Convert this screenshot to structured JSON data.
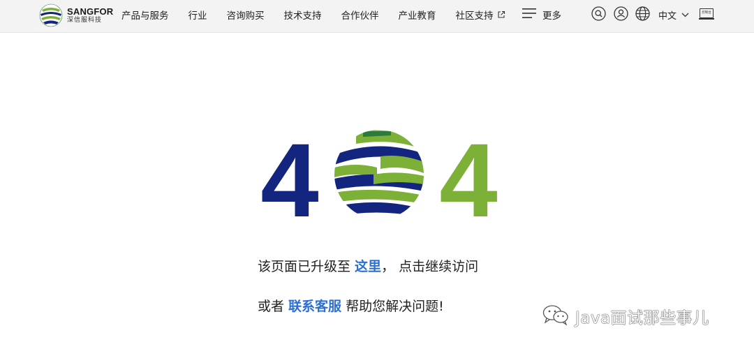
{
  "header": {
    "logo": {
      "brand": "SANGFOR",
      "subtitle": "深信服科技"
    },
    "nav": [
      {
        "label": "产品与服务",
        "external": false
      },
      {
        "label": "行业",
        "external": false
      },
      {
        "label": "咨询购买",
        "external": false
      },
      {
        "label": "技术支持",
        "external": false
      },
      {
        "label": "合作伙伴",
        "external": false
      },
      {
        "label": "产业教育",
        "external": false
      },
      {
        "label": "社区支持",
        "external": true
      }
    ],
    "more_label": "更多",
    "language": "中文",
    "console_label": "控制台",
    "icons": {
      "search": "search-icon",
      "user": "user-icon",
      "globe": "globe-icon",
      "menu": "menu-icon",
      "chevron": "chevron-down-icon",
      "external": "external-link-icon",
      "console": "console-icon"
    }
  },
  "error": {
    "code_digit_left": "4",
    "code_digit_right": "4",
    "line1_prefix": "该页面已升级至 ",
    "line1_link": "这里",
    "line1_suffix": "， 点击继续访问",
    "line2_prefix": "或者 ",
    "line2_link": "联系客服",
    "line2_suffix": " 帮助您解决问题!"
  },
  "watermark": {
    "text": "Java面试那些事儿"
  },
  "colors": {
    "navy": "#13257e",
    "green": "#7cb036",
    "dark_green": "#2e7a3c",
    "link": "#2b6fd6",
    "header_bg": "#f3f3f3"
  }
}
